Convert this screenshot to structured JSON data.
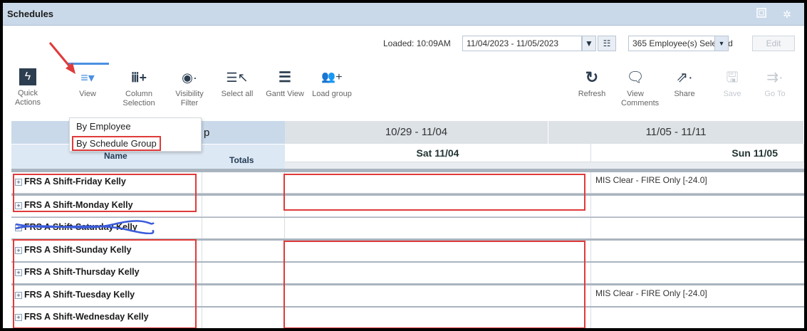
{
  "window": {
    "title": "Schedules",
    "icons": [
      "window-icon",
      "gear-icon"
    ]
  },
  "toolbar": {
    "loaded_label": "Loaded: 10:09AM",
    "date_range": "11/04/2023 - 11/05/2023",
    "employees_selected": "365 Employee(s) Selected",
    "edit_label": "Edit",
    "tools": [
      {
        "name": "quick-actions",
        "label": "Quick Actions",
        "icon": "lightning-icon"
      },
      {
        "name": "view",
        "label": "View",
        "icon": "view-list-icon"
      },
      {
        "name": "column-selection",
        "label": "Column Selection",
        "icon": "columns-icon"
      },
      {
        "name": "visibility-filter",
        "label": "Visibility Filter",
        "icon": "eye-icon"
      },
      {
        "name": "select-all",
        "label": "Select all",
        "icon": "select-all-icon"
      },
      {
        "name": "gantt-view",
        "label": "Gantt View",
        "icon": "gantt-icon"
      },
      {
        "name": "load-group",
        "label": "Load group",
        "icon": "group-add-icon"
      },
      {
        "name": "refresh",
        "label": "Refresh",
        "icon": "refresh-icon"
      },
      {
        "name": "view-comments",
        "label": "View Comments",
        "icon": "comments-icon"
      },
      {
        "name": "share",
        "label": "Share",
        "icon": "share-icon"
      },
      {
        "name": "save",
        "label": "Save",
        "icon": "save-icon"
      },
      {
        "name": "go-to",
        "label": "Go To",
        "icon": "go-to-icon"
      }
    ]
  },
  "view_menu": {
    "options": [
      "By Employee",
      "By Schedule Group"
    ],
    "selected": "By Schedule Group"
  },
  "grid": {
    "group_header_fragment": "p",
    "name_header": "Name",
    "totals_header": "Totals",
    "weeks": [
      "10/29 - 11/04",
      "11/05 - 11/11"
    ],
    "days": [
      "Sat 11/04",
      "Sun 11/05"
    ],
    "rows": [
      {
        "name": "FRS A Shift-Friday Kelly",
        "sun": "MIS Clear - FIRE Only  [-24.0]"
      },
      {
        "name": "FRS A Shift-Monday Kelly",
        "sun": ""
      },
      {
        "name": "FRS A Shift-Saturday Kelly",
        "sun": ""
      },
      {
        "name": "FRS A Shift-Sunday Kelly",
        "sun": ""
      },
      {
        "name": "FRS A Shift-Thursday Kelly",
        "sun": ""
      },
      {
        "name": "FRS A Shift-Tuesday Kelly",
        "sun": "MIS Clear - FIRE Only  [-24.0]"
      },
      {
        "name": "FRS A Shift-Wednesday Kelly",
        "sun": ""
      }
    ]
  },
  "colors": {
    "header_blue": "#c9d9ea",
    "annotation_red": "#e03a3a",
    "strike_blue": "#3a5bd9"
  }
}
